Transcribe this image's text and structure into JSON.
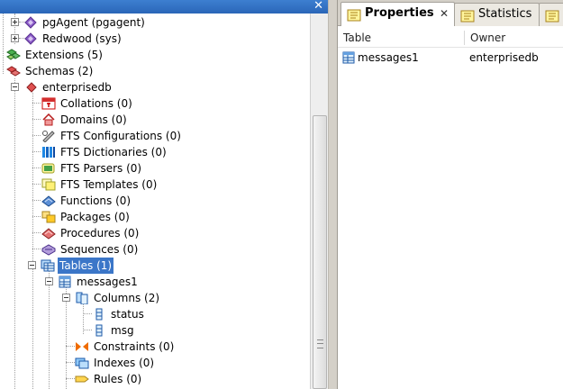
{
  "tree": {
    "items": [
      {
        "label": "pgAgent (pgagent)"
      },
      {
        "label": "Redwood (sys)"
      },
      {
        "label": "Extensions (5)"
      },
      {
        "label": "Schemas (2)"
      },
      {
        "label": "enterprisedb"
      },
      {
        "label": "Collations (0)"
      },
      {
        "label": "Domains (0)"
      },
      {
        "label": "FTS Configurations (0)"
      },
      {
        "label": "FTS Dictionaries (0)"
      },
      {
        "label": "FTS Parsers (0)"
      },
      {
        "label": "FTS Templates (0)"
      },
      {
        "label": "Functions (0)"
      },
      {
        "label": "Packages (0)"
      },
      {
        "label": "Procedures (0)"
      },
      {
        "label": "Sequences (0)"
      },
      {
        "label": "Tables (1)"
      },
      {
        "label": "messages1"
      },
      {
        "label": "Columns (2)"
      },
      {
        "label": "status"
      },
      {
        "label": "msg"
      },
      {
        "label": "Constraints (0)"
      },
      {
        "label": "Indexes (0)"
      },
      {
        "label": "Rules (0)"
      }
    ]
  },
  "tabs": [
    {
      "label": "Properties"
    },
    {
      "label": "Statistics"
    }
  ],
  "properties": {
    "columns": [
      "Table",
      "Owner"
    ],
    "rows": [
      {
        "table": "messages1",
        "owner": "enterprisedb"
      }
    ]
  }
}
